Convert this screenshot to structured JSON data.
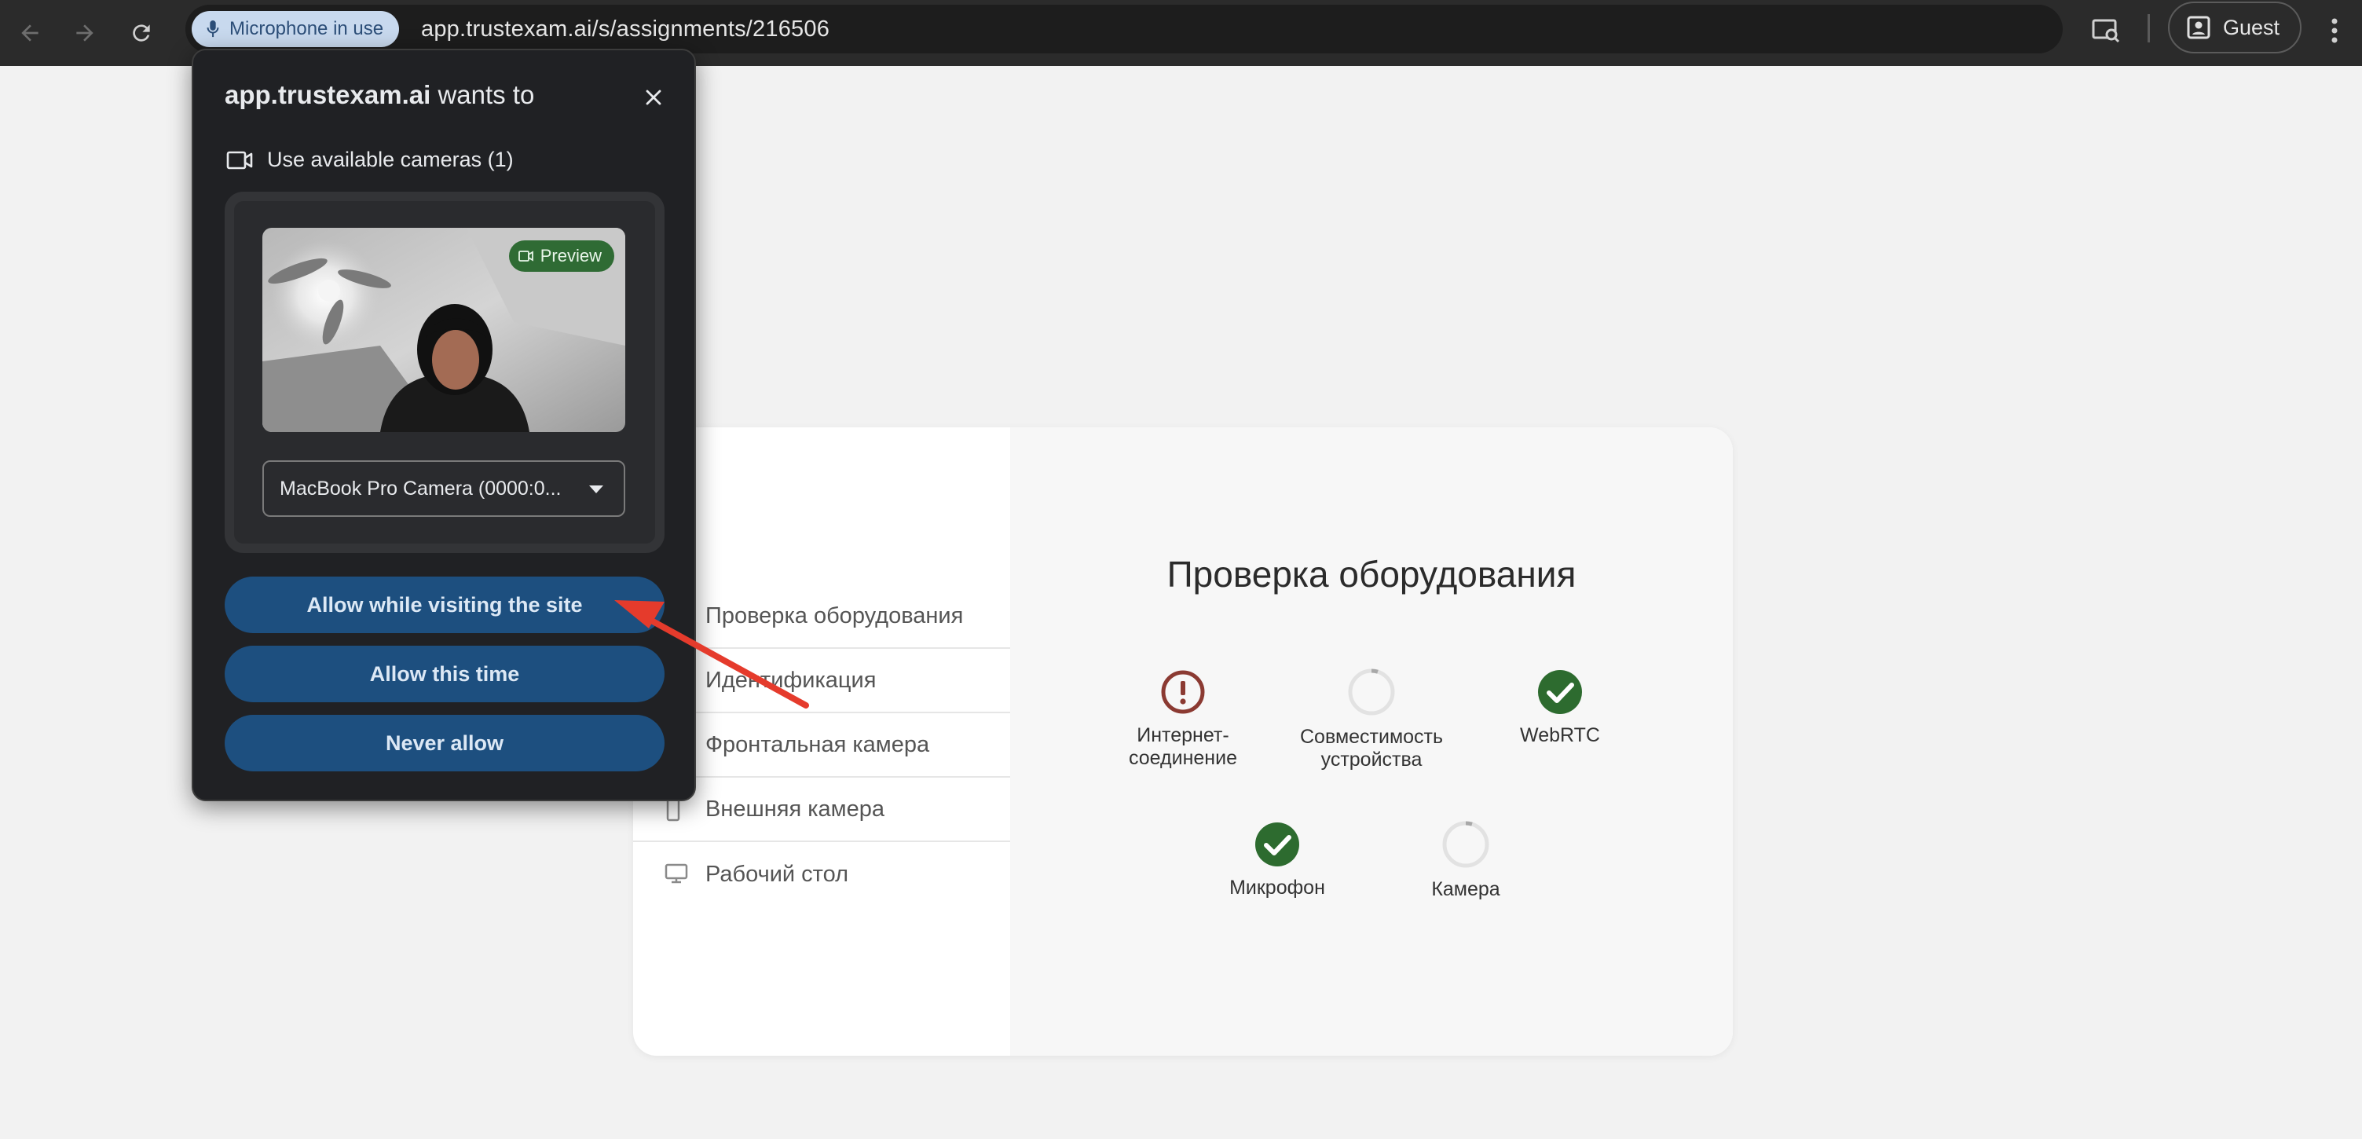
{
  "browser": {
    "mic_chip_label": "Microphone in use",
    "url": "app.trustexam.ai/s/assignments/216506",
    "profile_label": "Guest",
    "icons": [
      "back-arrow-icon",
      "forward-arrow-icon",
      "reload-icon",
      "microphone-icon",
      "cast-search-icon",
      "profile-icon",
      "kebab-menu-icon"
    ]
  },
  "popup": {
    "site": "app.trustexam.ai",
    "title_suffix": "wants to",
    "permission_label": "Use available cameras (1)",
    "preview_badge": "Preview",
    "camera_select_value": "MacBook Pro Camera (0000:0...",
    "buttons": {
      "allow_while_visiting": "Allow while visiting the site",
      "allow_this_time": "Allow this time",
      "never_allow": "Never allow"
    },
    "colors": {
      "button_bg": "#1d4f7f",
      "panel_bg": "#202124",
      "badge_bg": "#2f6b34"
    }
  },
  "page": {
    "steps": [
      {
        "label": "Проверка оборудования"
      },
      {
        "label": "Идентификация"
      },
      {
        "label": "Фронтальная камера"
      },
      {
        "label": "Внешняя камера"
      },
      {
        "label": "Рабочий стол"
      }
    ],
    "title": "Проверка оборудования",
    "checks": [
      {
        "label": "Интернет-",
        "label2": "соединение",
        "status": "error"
      },
      {
        "label": "Совместимость",
        "label2": "устройства",
        "status": "loading"
      },
      {
        "label": "WebRTC",
        "label2": "",
        "status": "success"
      },
      {
        "label": "Микрофон",
        "label2": "",
        "status": "success"
      },
      {
        "label": "Камера",
        "label2": "",
        "status": "loading"
      }
    ],
    "colors": {
      "error": "#8b3a32",
      "success": "#2d6b2f",
      "loading": "#d9d9d9"
    }
  },
  "annotation": {
    "arrow_color": "#e53b2c"
  }
}
